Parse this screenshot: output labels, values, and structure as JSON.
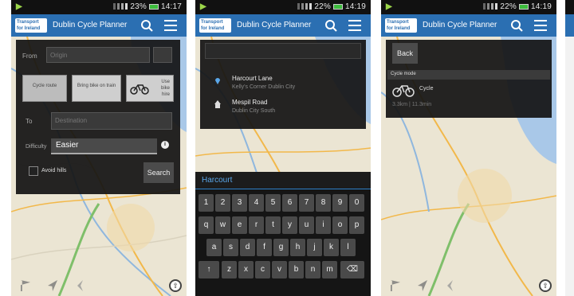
{
  "status": {
    "screens": [
      {
        "time": "14:17",
        "battery": "23%"
      },
      {
        "time": "14:19",
        "battery": "22%"
      },
      {
        "time": "14:19",
        "battery": "22%"
      }
    ]
  },
  "app": {
    "logo_line1": "Transport",
    "logo_line2": "for Ireland",
    "title": "Dublin Cycle Planner"
  },
  "planner": {
    "from_label": "From",
    "from_placeholder": "Origin",
    "route_options": [
      "Cycle route",
      "Bring bike on train",
      "Use bike hire"
    ],
    "to_label": "To",
    "to_placeholder": "Destination",
    "difficulty_label": "Difficulty",
    "difficulty_value": "Easier",
    "info_icon_text": "i",
    "avoid_hills_label": "Avoid hills",
    "search_button": "Search"
  },
  "suggestions": [
    {
      "title": "Harcourt Lane",
      "subtitle": "Kelly's Corner Dublin City"
    },
    {
      "title": "Mespil Road",
      "subtitle": "Dublin City South"
    }
  ],
  "keyboard": {
    "input_text": "Harcourt",
    "rows": [
      [
        "1",
        "2",
        "3",
        "4",
        "5",
        "6",
        "7",
        "8",
        "9",
        "0"
      ],
      [
        "q",
        "w",
        "e",
        "r",
        "t",
        "y",
        "u",
        "i",
        "o",
        "p"
      ],
      [
        "a",
        "s",
        "d",
        "f",
        "g",
        "h",
        "j",
        "k",
        "l"
      ],
      [
        "↑",
        "z",
        "x",
        "c",
        "v",
        "b",
        "n",
        "m",
        "⌫"
      ]
    ]
  },
  "result": {
    "back_button": "Back",
    "cycle_mode_label": "Cycle mode",
    "mode_name": "Cycle",
    "mode_meta": "3.3km | 11.3min"
  }
}
